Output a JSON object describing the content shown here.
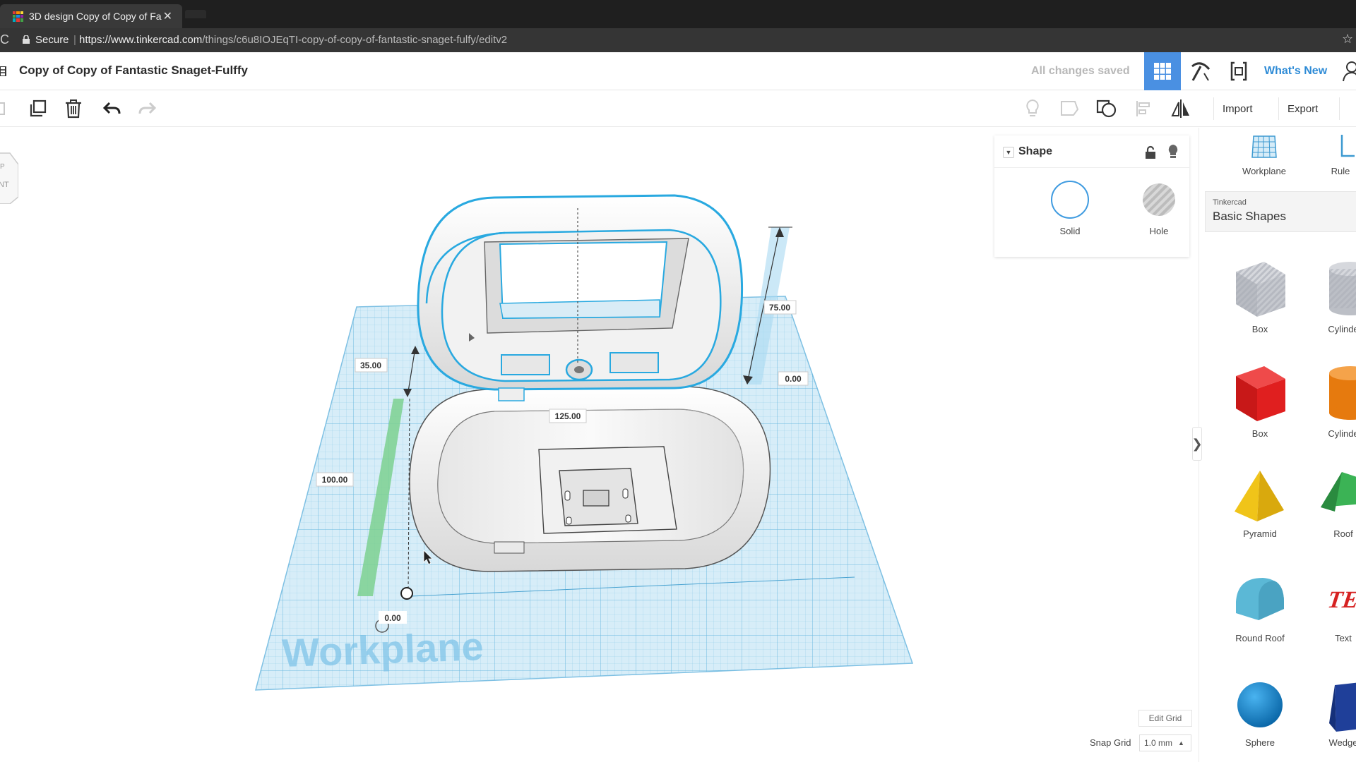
{
  "browser": {
    "tab_title": "3D design Copy of Copy of Fa",
    "secure_label": "Secure",
    "url_host": "https://www.tinkercad.com",
    "url_path": "/things/c6u8IOJEqTI-copy-of-copy-of-fantastic-snaget-fulfy/editv2"
  },
  "header": {
    "doc_title": "Copy of Copy of Fantastic Snaget-Fulffy",
    "save_status": "All changes saved",
    "whats_new": "What's New",
    "accent": "#4a90e2"
  },
  "toolbar": {
    "import_label": "Import",
    "export_label": "Export"
  },
  "viewport": {
    "workplane_label": "Workplane",
    "dimensions": {
      "height_left": "35.00",
      "height_right": "75.00",
      "elevation_right": "0.00",
      "width": "125.00",
      "depth": "100.00",
      "elevation_bottom": "0.00"
    }
  },
  "inspector": {
    "title": "Shape",
    "solid_label": "Solid",
    "hole_label": "Hole"
  },
  "shapes_panel": {
    "workplane_label": "Workplane",
    "ruler_label": "Rule",
    "library_source": "Tinkercad",
    "library_name": "Basic Shapes",
    "items": [
      {
        "label": "Box",
        "color": "#b9bcc3"
      },
      {
        "label": "Cylinde",
        "color": "#b9bcc3"
      },
      {
        "label": "Box",
        "color": "#e01f1f"
      },
      {
        "label": "Cylinde",
        "color": "#f08a1c"
      },
      {
        "label": "Pyramid",
        "color": "#f0c419"
      },
      {
        "label": "Roof",
        "color": "#2f9e44"
      },
      {
        "label": "Round Roof",
        "color": "#5bb8d6"
      },
      {
        "label": "Text",
        "color": "#d62222"
      },
      {
        "label": "Sphere",
        "color": "#1a8ad4"
      },
      {
        "label": "Wedge",
        "color": "#1f3f99"
      }
    ]
  },
  "grid": {
    "edit_grid_label": "Edit Grid",
    "snap_grid_label": "Snap Grid",
    "snap_value": "1.0 mm"
  }
}
